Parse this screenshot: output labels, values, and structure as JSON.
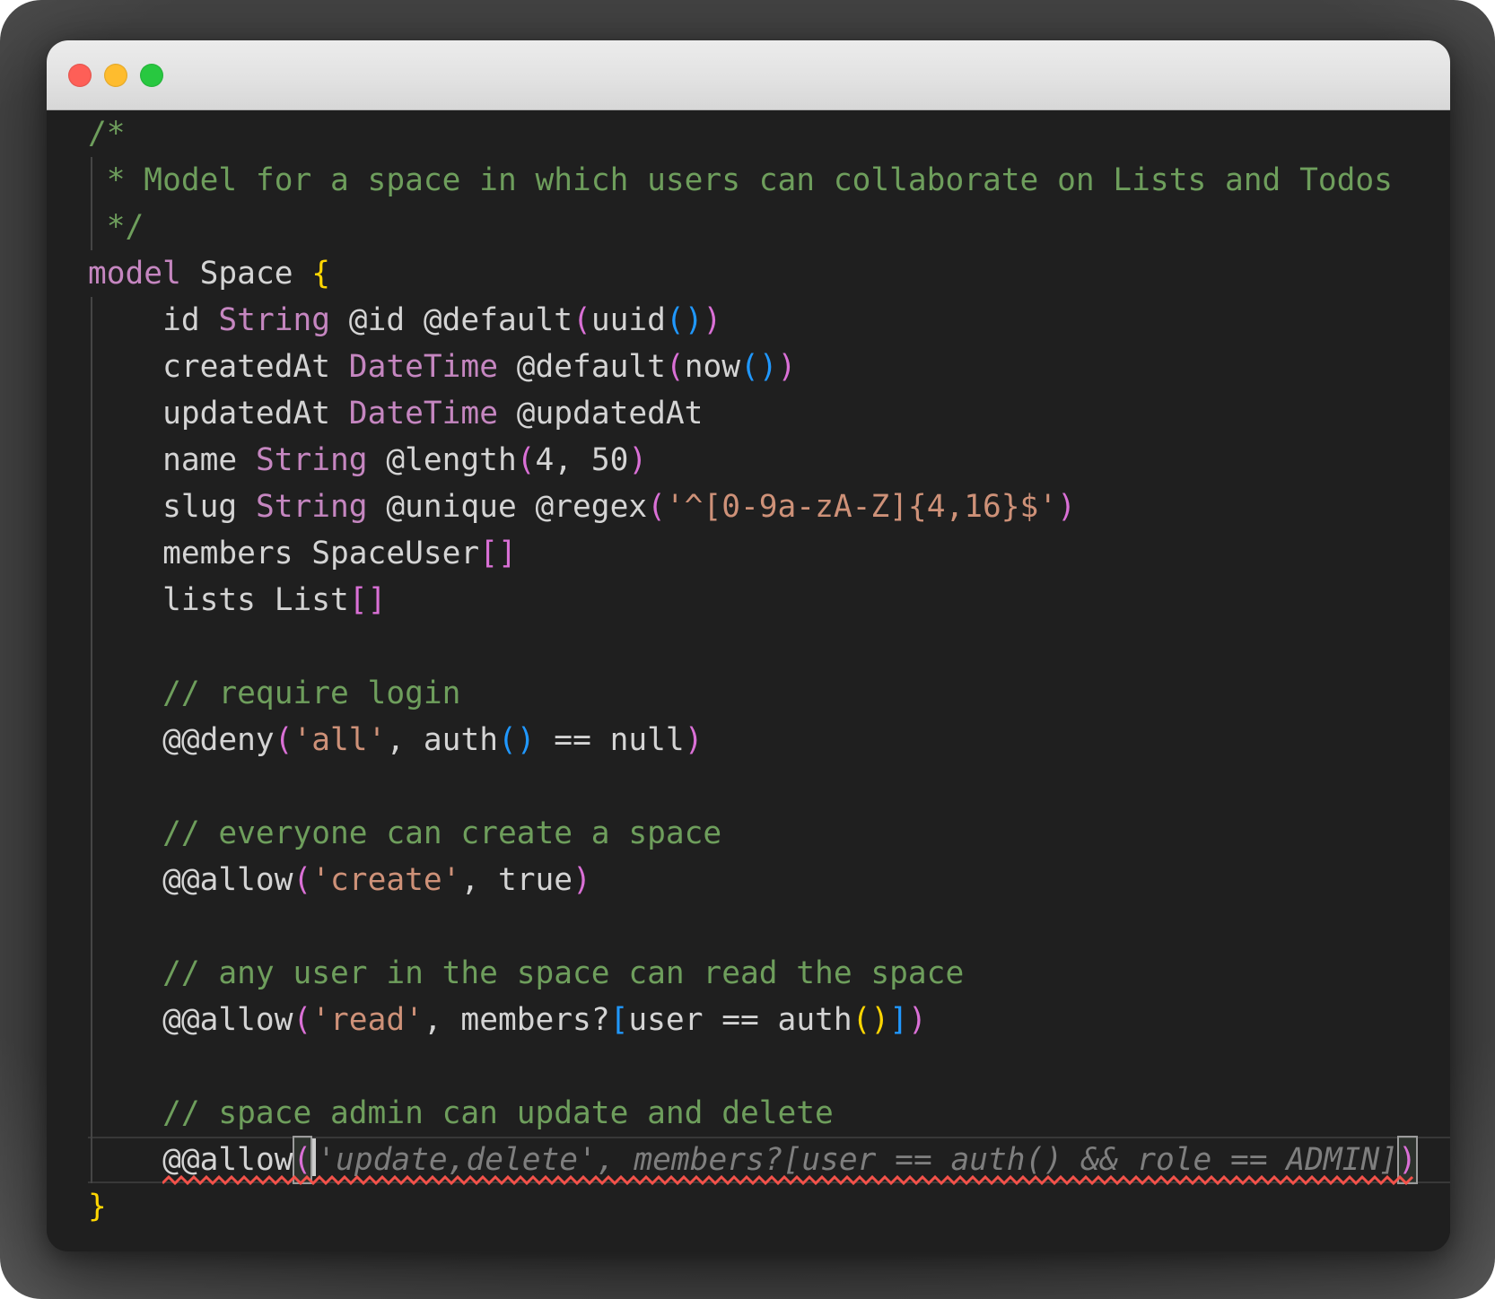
{
  "window": {
    "kind": "macos-code-editor-window",
    "titlebar_buttons": [
      {
        "name": "close",
        "color": "#fe5f57"
      },
      {
        "name": "minimize",
        "color": "#febc2e"
      },
      {
        "name": "maximize",
        "color": "#28c840"
      }
    ]
  },
  "editor": {
    "background": "#1f1f1f",
    "current_line": 23,
    "colors": {
      "text": "#d4d4d4",
      "comment": "#6e9e5c",
      "keyword": "#c586c0",
      "type": "#c586c0",
      "string": "#ce9178",
      "b1": "#ffd602",
      "b2": "#da70d6",
      "b3": "#2098ff",
      "ghost": "#7e7e7e",
      "squiggle": "#f3524a"
    },
    "indent_guides": [
      {
        "from": 2,
        "to": 3
      },
      {
        "from": 5,
        "to": 23
      }
    ],
    "lines": [
      {
        "tokens": [
          [
            "comment",
            "/*"
          ]
        ]
      },
      {
        "tokens": [
          [
            "comment",
            " * Model for a space in which users can collaborate on Lists and Todos"
          ]
        ]
      },
      {
        "tokens": [
          [
            "comment",
            " */"
          ]
        ]
      },
      {
        "tokens": [
          [
            "keyword",
            "model"
          ],
          [
            "text",
            " Space "
          ],
          [
            "b1",
            "{"
          ]
        ]
      },
      {
        "tokens": [
          [
            "text",
            "    id "
          ],
          [
            "type",
            "String"
          ],
          [
            "text",
            " @id @default"
          ],
          [
            "b2",
            "("
          ],
          [
            "text",
            "uuid"
          ],
          [
            "b3",
            "()"
          ],
          [
            "b2",
            ")"
          ]
        ]
      },
      {
        "tokens": [
          [
            "text",
            "    createdAt "
          ],
          [
            "type",
            "DateTime"
          ],
          [
            "text",
            " @default"
          ],
          [
            "b2",
            "("
          ],
          [
            "text",
            "now"
          ],
          [
            "b3",
            "()"
          ],
          [
            "b2",
            ")"
          ]
        ]
      },
      {
        "tokens": [
          [
            "text",
            "    updatedAt "
          ],
          [
            "type",
            "DateTime"
          ],
          [
            "text",
            " @updatedAt"
          ]
        ]
      },
      {
        "tokens": [
          [
            "text",
            "    name "
          ],
          [
            "type",
            "String"
          ],
          [
            "text",
            " @length"
          ],
          [
            "b2",
            "("
          ],
          [
            "text",
            "4, 50"
          ],
          [
            "b2",
            ")"
          ]
        ]
      },
      {
        "tokens": [
          [
            "text",
            "    slug "
          ],
          [
            "type",
            "String"
          ],
          [
            "text",
            " @unique @regex"
          ],
          [
            "b2",
            "("
          ],
          [
            "string",
            "'^[0-9a-zA-Z]{4,16}$'"
          ],
          [
            "b2",
            ")"
          ]
        ]
      },
      {
        "tokens": [
          [
            "text",
            "    members SpaceUser"
          ],
          [
            "b2",
            "[]"
          ]
        ]
      },
      {
        "tokens": [
          [
            "text",
            "    lists List"
          ],
          [
            "b2",
            "[]"
          ]
        ]
      },
      {
        "tokens": []
      },
      {
        "tokens": [
          [
            "comment",
            "    // require login"
          ]
        ]
      },
      {
        "tokens": [
          [
            "text",
            "    @@deny"
          ],
          [
            "b2",
            "("
          ],
          [
            "string",
            "'all'"
          ],
          [
            "text",
            ", auth"
          ],
          [
            "b3",
            "()"
          ],
          [
            "text",
            " == null"
          ],
          [
            "b2",
            ")"
          ]
        ]
      },
      {
        "tokens": []
      },
      {
        "tokens": [
          [
            "comment",
            "    // everyone can create a space"
          ]
        ]
      },
      {
        "tokens": [
          [
            "text",
            "    @@allow"
          ],
          [
            "b2",
            "("
          ],
          [
            "string",
            "'create'"
          ],
          [
            "text",
            ", true"
          ],
          [
            "b2",
            ")"
          ]
        ]
      },
      {
        "tokens": []
      },
      {
        "tokens": [
          [
            "comment",
            "    // any user in the space can read the space"
          ]
        ]
      },
      {
        "tokens": [
          [
            "text",
            "    @@allow"
          ],
          [
            "b2",
            "("
          ],
          [
            "string",
            "'read'"
          ],
          [
            "text",
            ", members?"
          ],
          [
            "b3",
            "["
          ],
          [
            "text",
            "user == auth"
          ],
          [
            "b1",
            "()"
          ],
          [
            "b3",
            "]"
          ],
          [
            "b2",
            ")"
          ]
        ]
      },
      {
        "tokens": []
      },
      {
        "tokens": [
          [
            "comment",
            "    // space admin can update and delete"
          ]
        ]
      },
      {
        "tokens": [
          [
            "text",
            "    "
          ],
          [
            "text",
            "@@allow"
          ],
          [
            "b2 match",
            "("
          ],
          [
            "cursor",
            ""
          ],
          [
            "ghost",
            "'update,delete', members?[user == auth() && role == ADMIN]"
          ],
          [
            "b2 match",
            ")"
          ]
        ],
        "squiggle_from": 1
      },
      {
        "tokens": [
          [
            "b1",
            "}"
          ]
        ]
      }
    ]
  }
}
